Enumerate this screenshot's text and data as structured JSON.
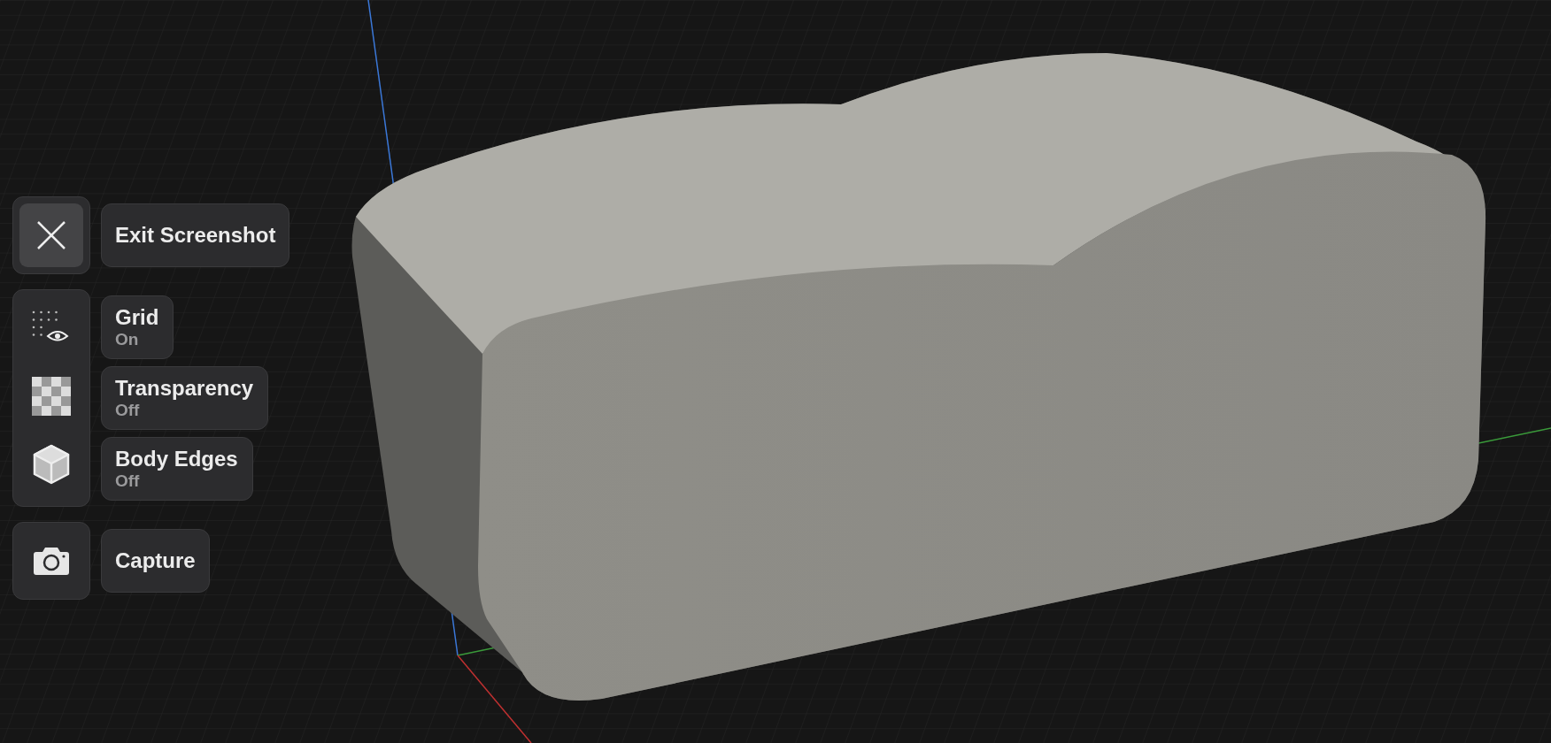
{
  "exit_button": {
    "label": "Exit Screenshot"
  },
  "toggles": [
    {
      "kind": "grid",
      "label": "Grid",
      "value": "On"
    },
    {
      "kind": "transparency",
      "label": "Transparency",
      "value": "Off"
    },
    {
      "kind": "edges",
      "label": "Body Edges",
      "value": "Off"
    }
  ],
  "capture_button": {
    "label": "Capture"
  }
}
